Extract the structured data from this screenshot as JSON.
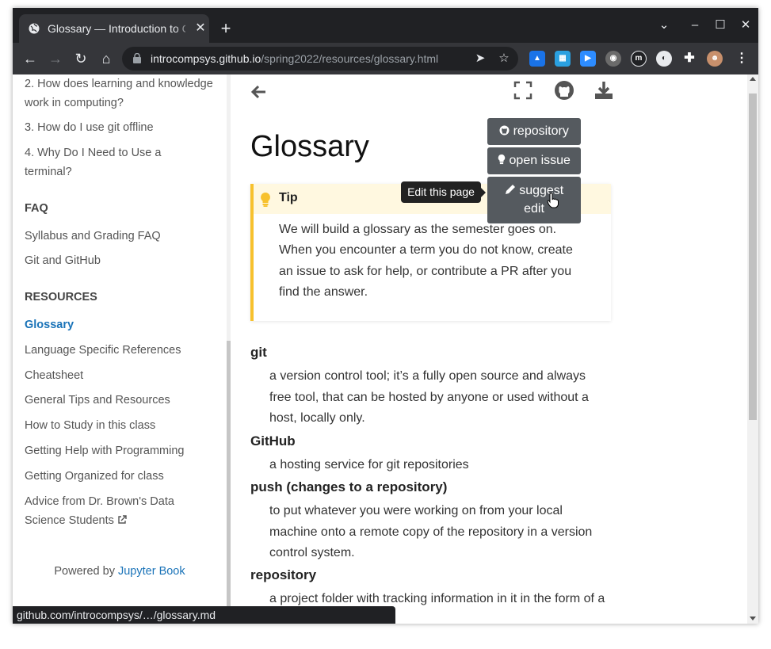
{
  "browser": {
    "tab_title": "Glossary — Introduction to Computer Systems",
    "url_host": "introcompsys.github.io",
    "url_path": "/spring2022/resources/glossary.html",
    "status_url": "github.com/introcompsys/…/glossary.md"
  },
  "sidebar": {
    "items_top": [
      "2. How does learning and knowledge work in computing?",
      "3. How do I use git offline",
      "4. Why Do I Need to Use a terminal?"
    ],
    "faq_heading": "FAQ",
    "faq_items": [
      "Syllabus and Grading FAQ",
      "Git and GitHub"
    ],
    "resources_heading": "RESOURCES",
    "resources_items": [
      "Glossary",
      "Language Specific References",
      "Cheatsheet",
      "General Tips and Resources",
      "How to Study in this class",
      "Getting Help with Programming",
      "Getting Organized for class",
      "Advice from Dr. Brown's Data Science Students"
    ],
    "powered_by": "Powered by",
    "powered_link": "Jupyter Book"
  },
  "main": {
    "title": "Glossary",
    "dropdown": {
      "repository": "repository",
      "open_issue": "open issue",
      "suggest_edit": "suggest edit"
    },
    "tooltip": "Edit this page",
    "tip": {
      "title": "Tip",
      "body": "We will build a glossary as the semester goes on. When you encounter a term you do not know, create an issue to ask for help, or contribute a PR after you find the answer."
    },
    "terms": [
      {
        "term": "git",
        "definition": "a version control tool; it’s a fully open source and always free tool, that can be hosted by anyone or used without a host, locally only."
      },
      {
        "term": "GitHub",
        "definition": "a hosting service for git repositories"
      },
      {
        "term": "push (changes to a repository)",
        "definition": "to put whatever you were working on from your local machine onto a remote copy of the repository in a version control system."
      },
      {
        "term": "repository",
        "definition": "a project folder with tracking information in it in the form of a"
      }
    ]
  },
  "colors": {
    "link": "#1a73b8",
    "tip_accent": "#f7c12d",
    "dropdown_bg": "#555a5f"
  }
}
